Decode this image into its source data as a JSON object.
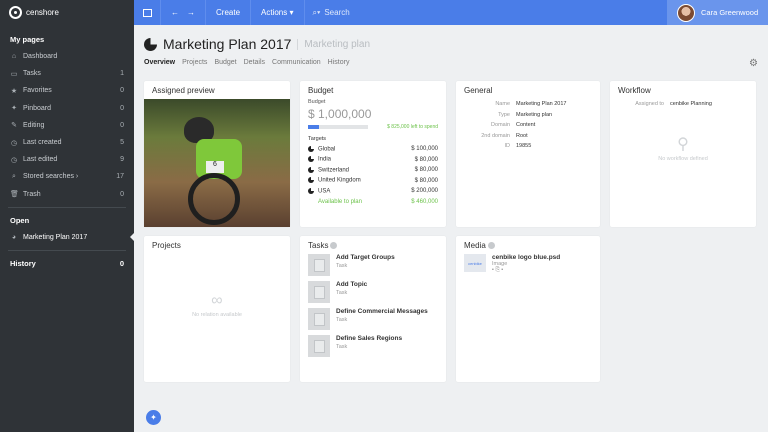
{
  "app": {
    "logo": "censhore"
  },
  "sidebar": {
    "my_pages": "My pages",
    "items": [
      {
        "icon": "⌂",
        "label": "Dashboard",
        "count": ""
      },
      {
        "icon": "▭",
        "label": "Tasks",
        "count": "1"
      },
      {
        "icon": "★",
        "label": "Favorites",
        "count": "0"
      },
      {
        "icon": "✦",
        "label": "Pinboard",
        "count": "0"
      },
      {
        "icon": "✎",
        "label": "Editing",
        "count": "0"
      },
      {
        "icon": "◷",
        "label": "Last created",
        "count": "5"
      },
      {
        "icon": "◷",
        "label": "Last edited",
        "count": "9"
      },
      {
        "icon": "⌕",
        "label": "Stored searches ›",
        "count": "17"
      },
      {
        "icon": "🗑",
        "label": "Trash",
        "count": "0"
      }
    ],
    "open": "Open",
    "open_item": "Marketing Plan 2017",
    "history": "History",
    "history_count": "0"
  },
  "topbar": {
    "create": "Create",
    "actions": "Actions ▾",
    "search": "Search",
    "user": "Cara Greenwood"
  },
  "page": {
    "title": "Marketing Plan 2017",
    "subtitle": "Marketing plan",
    "tabs": [
      "Overview",
      "Projects",
      "Budget",
      "Details",
      "Communication",
      "History"
    ]
  },
  "cards": {
    "preview": {
      "title": "Assigned preview"
    },
    "budget": {
      "title": "Budget",
      "label": "Budget",
      "amount": "$ 1,000,000",
      "left": "$ 825,000 left to spend",
      "targets_label": "Targets",
      "rows": [
        {
          "name": "Global",
          "value": "$ 100,000"
        },
        {
          "name": "India",
          "value": "$ 80,000"
        },
        {
          "name": "Switzerland",
          "value": "$ 80,000"
        },
        {
          "name": "United Kingdom",
          "value": "$ 80,000"
        },
        {
          "name": "USA",
          "value": "$ 200,000"
        }
      ],
      "available_label": "Available to plan",
      "available_value": "$ 460,000"
    },
    "general": {
      "title": "General",
      "rows": [
        {
          "k": "Name",
          "v": "Marketing Plan 2017"
        },
        {
          "k": "Type",
          "v": "Marketing plan"
        },
        {
          "k": "Domain",
          "v": "Content"
        },
        {
          "k": "2nd domain",
          "v": "Root"
        },
        {
          "k": "ID",
          "v": "19855"
        }
      ]
    },
    "workflow": {
      "title": "Workflow",
      "assigned_label": "Assigned to",
      "assigned_value": "cenbike Planning",
      "empty": "No workflow defined"
    },
    "projects": {
      "title": "Projects",
      "empty": "No relation available"
    },
    "tasks": {
      "title": "Tasks",
      "items": [
        {
          "name": "Add Target Groups",
          "type": "Task"
        },
        {
          "name": "Add Topic",
          "type": "Task"
        },
        {
          "name": "Define Commercial Messages",
          "type": "Task"
        },
        {
          "name": "Define Sales Regions",
          "type": "Task"
        }
      ]
    },
    "media": {
      "title": "Media",
      "file": "cenbike logo blue.psd",
      "type": "Image"
    }
  }
}
